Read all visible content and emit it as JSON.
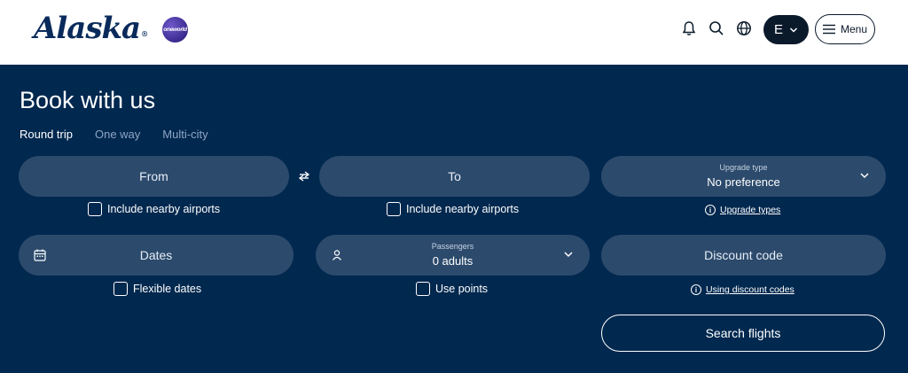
{
  "header": {
    "logo_text": "Alaska",
    "logo_mark": "®",
    "oneworld_text": "oneworld",
    "user_initial": "E",
    "menu_label": "Menu",
    "icons": [
      "bell-icon",
      "search-icon",
      "globe-icon",
      "chevron-down-icon",
      "hamburger-icon"
    ]
  },
  "booking": {
    "title": "Book with us",
    "tabs": [
      {
        "label": "Round trip",
        "active": true
      },
      {
        "label": "One way",
        "active": false
      },
      {
        "label": "Multi-city",
        "active": false
      }
    ],
    "from_label": "From",
    "to_label": "To",
    "upgrade": {
      "label": "Upgrade type",
      "value": "No preference"
    },
    "nearby_from": "Include nearby airports",
    "nearby_to": "Include nearby airports",
    "upgrade_link": "Upgrade types",
    "dates_label": "Dates",
    "passengers": {
      "label": "Passengers",
      "value": "0 adults"
    },
    "discount_label": "Discount code",
    "flexible_dates": "Flexible dates",
    "use_points": "Use points",
    "discount_link": "Using discount codes",
    "search_label": "Search flights"
  },
  "colors": {
    "background": "#01284f",
    "field": "#2c4a6c",
    "header": "#ffffff",
    "logo": "#0a2a5c"
  }
}
